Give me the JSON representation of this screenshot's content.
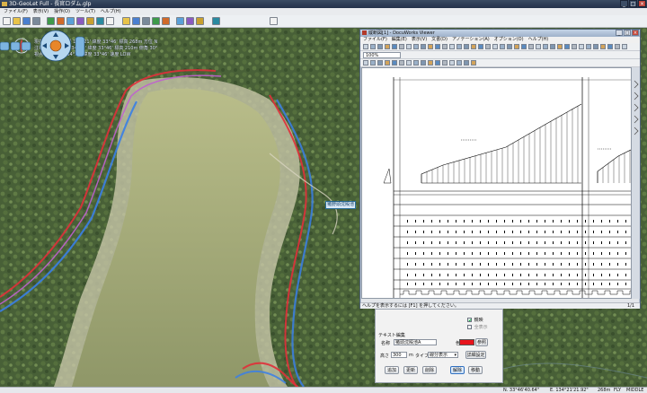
{
  "app": {
    "title": "3D-GeoLet Full - 長官ロダム.glp",
    "menu": [
      "ファイル(F)",
      "表示(V)",
      "操作(O)",
      "ツール(T)",
      "ヘルプ(H)"
    ]
  },
  "toolbar_icons": [
    "new-icon",
    "open-icon",
    "save-icon",
    "print-icon",
    "move-icon",
    "import-icon",
    "export-icon",
    "layer-icon",
    "layer-icon-2",
    "layer-icon-3",
    "terrain-icon",
    "terrain-icon-2",
    "contour-icon",
    "contour-icon-2",
    "section-icon",
    "section-icon-2",
    "draw-icon",
    "line-icon",
    "point-icon",
    "settings-icon",
    "help-icon"
  ],
  "hud": {
    "lines": [
      "現在視点位置 東経 134°21' 緯度 33°46' 標高 268m 方位 N",
      "注視点位置 東経 134°22' 緯度 33°46' 標高 210m 俯角 30°",
      "視点移動 東経 134°21' 緯度 33°46' 速度 LOW"
    ]
  },
  "map_label": "猪野頭沈殿池",
  "status": {
    "lat": "N. 33°46'40.64\"",
    "lon": "E. 134°21'21.92\"",
    "alt": "268m",
    "mode": "FLY",
    "speed": "MIDDLE"
  },
  "viewer": {
    "title": "縦断図[1] - DocuWorks Viewer",
    "menu": [
      "ファイル(F)",
      "編集(E)",
      "表示(V)",
      "文書(D)",
      "アノテーション(A)",
      "オプション(O)",
      "ヘルプ(H)"
    ],
    "zoom": "100%",
    "status_message": "ヘルプを表示するには [F1] を押してください。",
    "page": "1/1"
  },
  "dialog": {
    "mirror_label": "鏡映",
    "show_all_label": "全表示",
    "section_label": "テキスト編集",
    "name_label": "名称",
    "name_value": "猪頭沈殿池A",
    "color_label": "色",
    "color_value": "#e8141c",
    "ref_button": "参照",
    "height_label": "高さ",
    "height_value": "300",
    "height_unit": "m",
    "type_label": "タイプ",
    "type_value": "線分表示",
    "detail_button": "詳細設定",
    "buttons": [
      "追加",
      "更新",
      "削除",
      "解除",
      "移動"
    ]
  },
  "colors": {
    "titlebar": "#23314a",
    "lake": "#a9ad7c",
    "contour_blue": "#3a7fe6",
    "contour_red": "#e0303a",
    "contour_magenta": "#c060d0"
  }
}
